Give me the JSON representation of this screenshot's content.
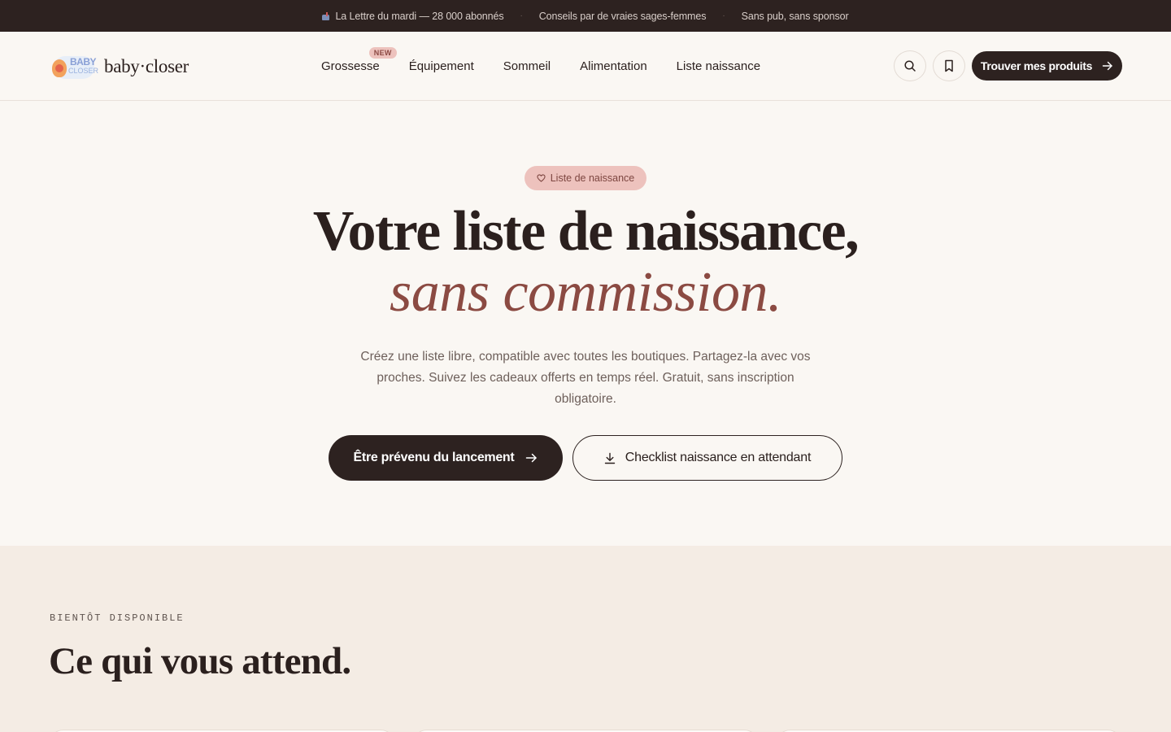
{
  "topbar": {
    "items": [
      "La Lettre du mardi — 28 000 abonnés",
      "Conseils par de vraies sages-femmes",
      "Sans pub, sans sponsor"
    ],
    "separator": "·"
  },
  "header": {
    "logo_text": "baby·closer",
    "logo_badge_line1": "BABY",
    "logo_badge_line2": "CLOSER",
    "nav": [
      {
        "label": "Grossesse",
        "badge": "NEW"
      },
      {
        "label": "Équipement"
      },
      {
        "label": "Sommeil"
      },
      {
        "label": "Alimentation"
      },
      {
        "label": "Liste naissance"
      }
    ],
    "cta_label": "Trouver mes produits"
  },
  "hero": {
    "pill_label": "Liste de naissance",
    "title_line1": "Votre liste de naissance,",
    "title_line2": "sans commission.",
    "description": "Créez une liste libre, compatible avec toutes les boutiques. Partagez-la avec vos proches. Suivez les cadeaux offerts en temps réel. Gratuit, sans inscription obligatoire.",
    "primary_button": "Être prévenu du lancement",
    "secondary_button": "Checklist naissance en attendant"
  },
  "coming_soon": {
    "eyebrow": "BIENTÔT DISPONIBLE",
    "title": "Ce qui vous attend."
  },
  "colors": {
    "dark": "#2d2220",
    "accent": "#8b4a42",
    "pill": "#edc2bd",
    "background": "#faf7f3",
    "section_bg": "#f4ece4"
  }
}
